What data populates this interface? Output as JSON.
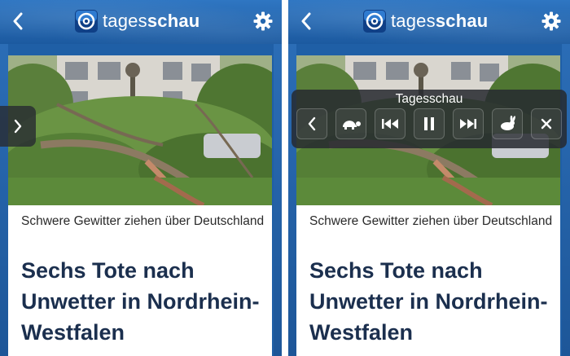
{
  "screens": [
    {
      "logo": {
        "text_regular": "tages",
        "text_bold": "schau"
      },
      "article": {
        "teaser": "Schwere Gewitter ziehen über Deutschland",
        "headline": "Sechs Tote nach Unwetter in Nordrhein-Westfalen"
      },
      "icons": {
        "back": "chevron-left-icon",
        "settings": "gear-icon",
        "next": "chevron-right-icon"
      }
    },
    {
      "logo": {
        "text_regular": "tages",
        "text_bold": "schau"
      },
      "article": {
        "teaser": "Schwere Gewitter ziehen über Deutschland",
        "headline": "Sechs Tote nach Unwetter in Nordrhein-Westfalen"
      },
      "player": {
        "title": "Tagesschau",
        "controls": [
          "chevron-left-icon",
          "turtle-slow-icon",
          "skip-back-icon",
          "pause-icon",
          "skip-forward-icon",
          "rabbit-fast-icon",
          "close-icon"
        ]
      }
    }
  ],
  "colors": {
    "brand_blue": "#1f5fa6",
    "headline": "#1b2f4e",
    "overlay": "#262a30"
  }
}
